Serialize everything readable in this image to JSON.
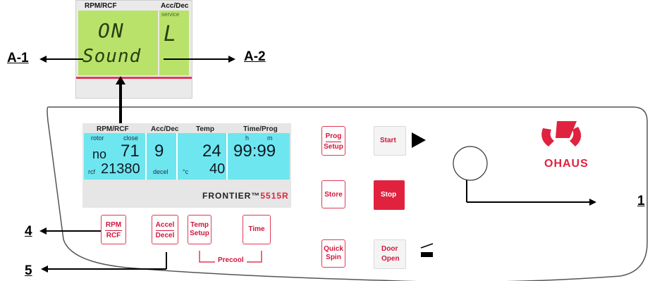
{
  "callouts": {
    "a1": "A-1",
    "a2": "A-2",
    "one": "1",
    "four": "4",
    "five": "5"
  },
  "inset_lcd": {
    "header_left": "RPM/RCF",
    "header_right": "Acc/Dec",
    "line1": "ON",
    "line2": "Sound",
    "right_small": "service",
    "right_char": "L"
  },
  "display": {
    "headers": [
      "RPM/RCF",
      "Acc/Dec",
      "Temp",
      "Time/Prog"
    ],
    "rotor_label": "rotor",
    "close_label": "close",
    "rotor_value": "no",
    "rpm_value": "71",
    "accdec_value": "9",
    "temp_value": "24",
    "time_h_label": "h",
    "time_m_label": "m",
    "time_value": "99:99",
    "rcf_label": "rcf",
    "rcf_value": "21380",
    "decel_label": "decel",
    "celsius_label": "°c",
    "temp_set_value": "40",
    "brand_model": "FRONTIER",
    "brand_tm": "™",
    "model_code": "5515R"
  },
  "buttons": {
    "prog": "Prog",
    "setup": "Setup",
    "start": "Start",
    "store": "Store",
    "stop": "Stop",
    "quick": "Quick",
    "spin": "Spin",
    "door": "Door",
    "open": "Open",
    "rpm": "RPM",
    "rcf": "RCF",
    "accel": "Accel",
    "decel": "Decel",
    "temp": "Temp",
    "temp_setup": "Setup",
    "time": "Time",
    "precool": "Precool"
  },
  "logo": {
    "text": "OHAUS"
  },
  "colors": {
    "accent_red": "#e0223f",
    "lcd_green": "#b9e26a",
    "display_cyan": "#6ee6f0"
  }
}
